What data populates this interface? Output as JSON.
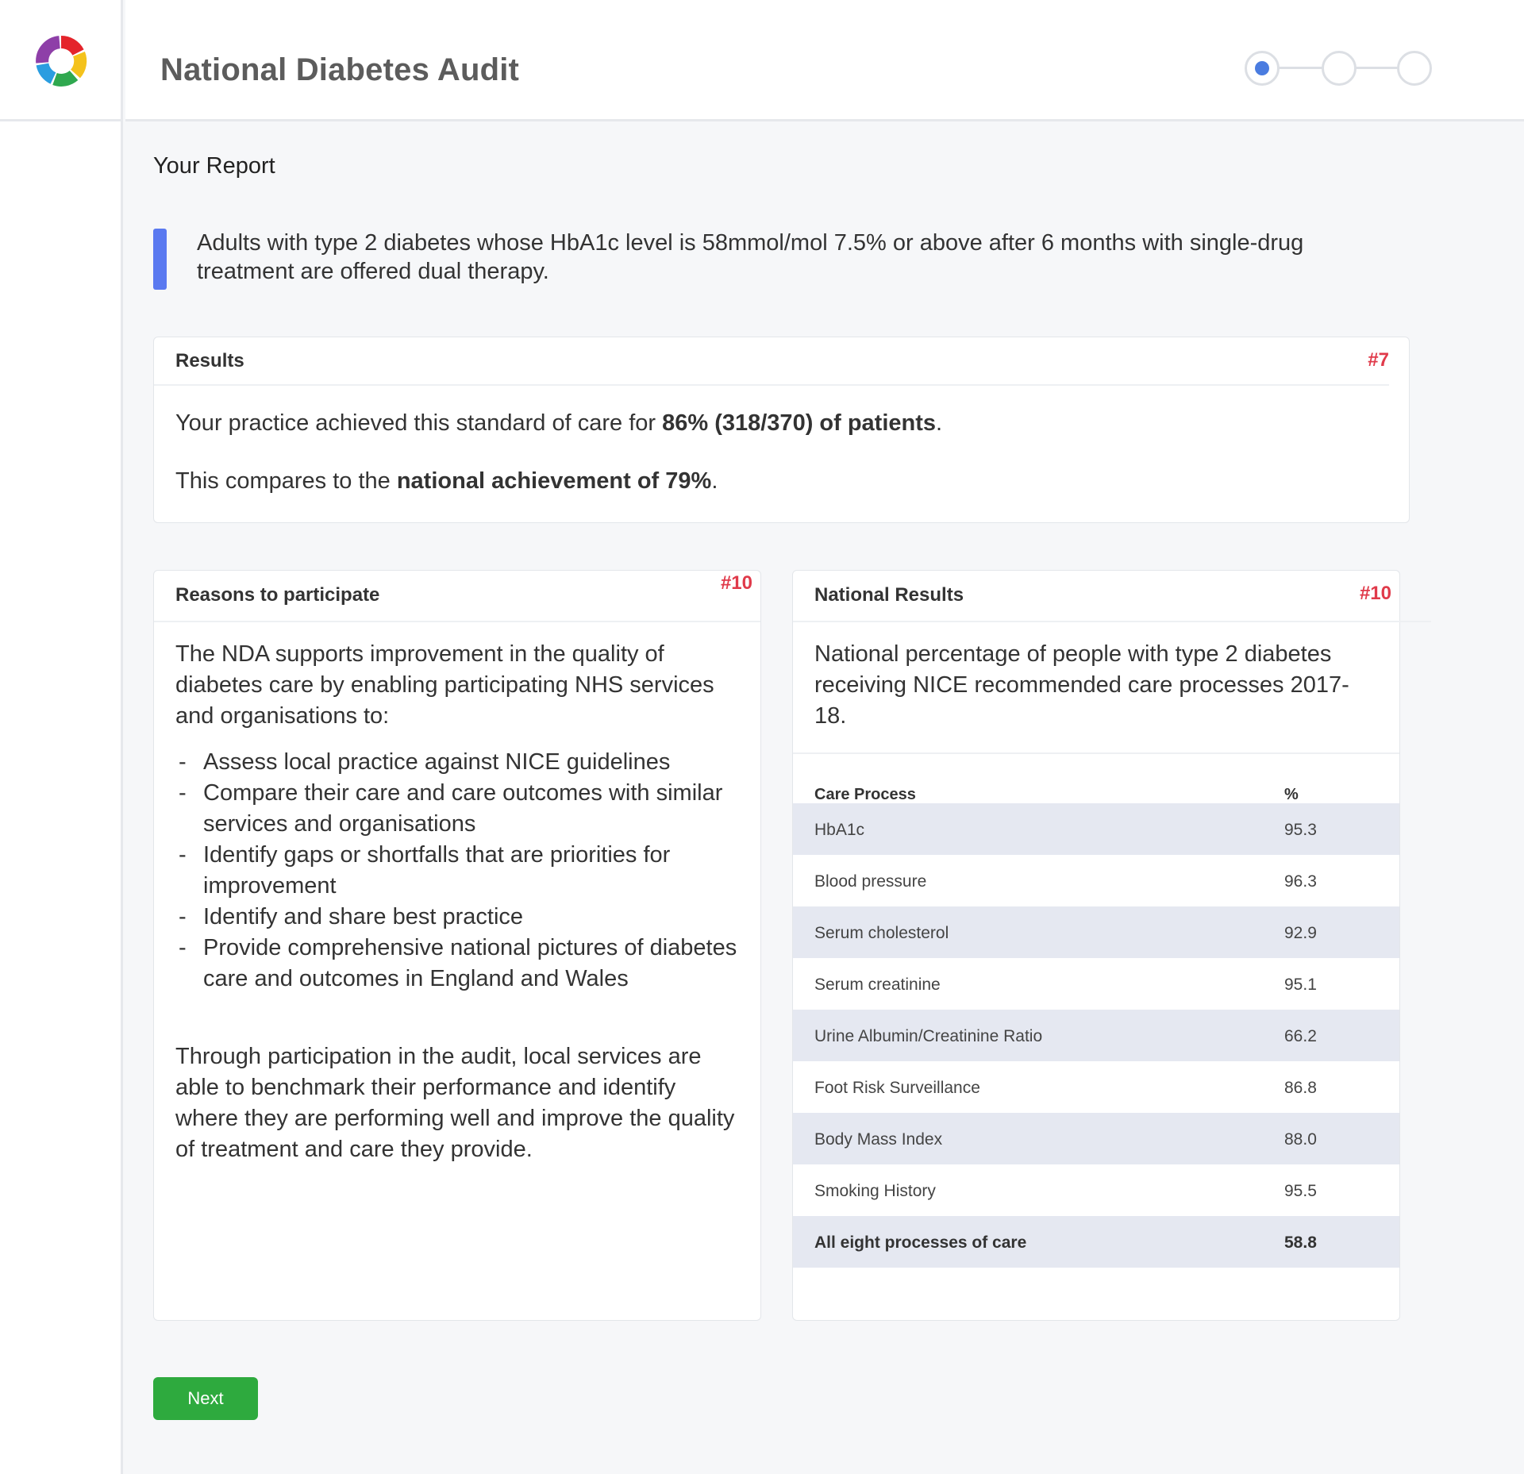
{
  "app": {
    "title": "National Diabetes Audit"
  },
  "stepper": {
    "steps": 3,
    "current": 1
  },
  "page": {
    "heading": "Your Report"
  },
  "callout": {
    "text": "Adults with type 2 diabetes whose HbA1c level is 58mmol/mol 7.5% or above after 6 months with single-drug treatment are offered dual therapy."
  },
  "results": {
    "title": "Results",
    "id": "#7",
    "line1_prefix": "Your practice achieved this standard of care for ",
    "line1_bold": "86% (318/370) of patients",
    "line1_suffix": ".",
    "line2_prefix": "This compares to the ",
    "line2_bold": "national achievement of 79%",
    "line2_suffix": "."
  },
  "reasons": {
    "title": "Reasons to participate",
    "id": "#10",
    "intro": "The NDA supports improvement in the quality of diabetes care by enabling participating NHS services and organisations to:",
    "bullet_marker": "-",
    "bullets": [
      "Assess local practice against NICE guidelines",
      "Compare their care and care outcomes with similar services and organisations",
      "Identify gaps or shortfalls that are priorities for improvement",
      "Identify and share best practice",
      "Provide comprehensive national pictures of diabetes care and outcomes in England and Wales"
    ],
    "outro": "Through participation in the audit, local services are able to benchmark their performance and identify where they are performing well and improve the quality of treatment and care they provide."
  },
  "national": {
    "title": "National Results",
    "id": "#10",
    "description": "National percentage of people with type 2 diabetes receiving NICE recommended care processes 2017-18.",
    "table": {
      "col_process": "Care Process",
      "col_percent": "%",
      "rows": [
        {
          "process": "HbA1c",
          "percent": "95.3"
        },
        {
          "process": "Blood pressure",
          "percent": "96.3"
        },
        {
          "process": "Serum cholesterol",
          "percent": "92.9"
        },
        {
          "process": "Serum creatinine",
          "percent": "95.1"
        },
        {
          "process": "Urine Albumin/Creatinine Ratio",
          "percent": "66.2"
        },
        {
          "process": "Foot Risk Surveillance",
          "percent": "86.8"
        },
        {
          "process": "Body Mass Index",
          "percent": "88.0"
        },
        {
          "process": "Smoking History",
          "percent": "95.5"
        },
        {
          "process": "All eight processes of care",
          "percent": "58.8"
        }
      ]
    }
  },
  "actions": {
    "next_label": "Next"
  },
  "colors": {
    "accent": "#5a79f0",
    "step_active": "#4a7ce0",
    "card_id": "#e03a4a",
    "next_button": "#2eaa3e",
    "row_shade": "#e5e8f1"
  },
  "icons": {
    "logo": "nda-logo-ring-icon"
  }
}
